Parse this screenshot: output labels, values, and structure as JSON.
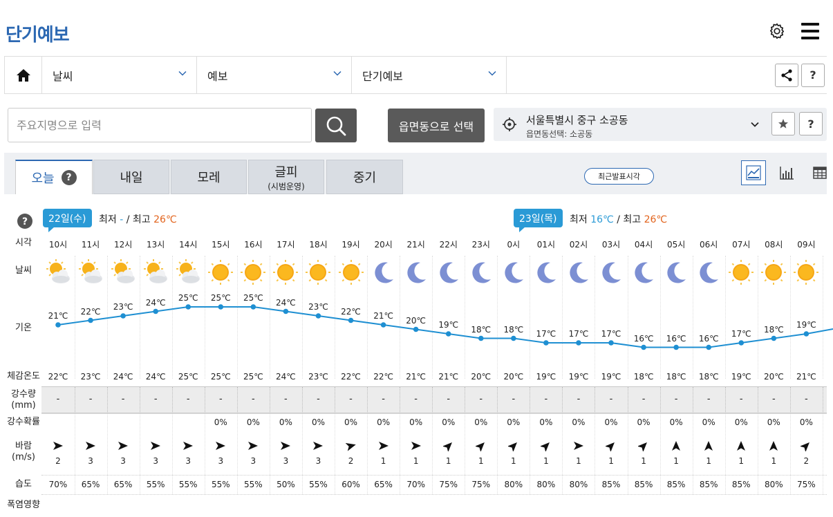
{
  "header": {
    "title": "단기예보"
  },
  "nav": {
    "items": [
      "날씨",
      "예보",
      "단기예보"
    ],
    "help": "?"
  },
  "search": {
    "placeholder": "주요지명으로 입력",
    "dong_button": "읍면동으로 선택"
  },
  "location": {
    "main": "서울특별시 중구 소공동",
    "sub": "읍면동선택: 소공동",
    "help": "?"
  },
  "tabs": [
    {
      "label": "오늘"
    },
    {
      "label": "내일"
    },
    {
      "label": "모레"
    },
    {
      "label": "글피",
      "sub": "(시범운영)"
    },
    {
      "label": "중기"
    }
  ],
  "tab_help": "?",
  "recent_button": "최근발표시각",
  "help_icon": "?",
  "days": [
    {
      "label": "22일(수)",
      "min_label": "최저",
      "min": "-",
      "sep": "/",
      "max_label": "최고",
      "max": "26℃"
    },
    {
      "label": "23일(목)",
      "min_label": "최저",
      "min": "16℃",
      "sep": "/",
      "max_label": "최고",
      "max": "26℃"
    }
  ],
  "row_labels": {
    "time": "시각",
    "weather": "날씨",
    "temp": "기온",
    "feel": "체감온도",
    "rain_line1": "강수량",
    "rain_line2": "(mm)",
    "prob": "강수확률",
    "wind_line1": "바람",
    "wind_line2": "(m/s)",
    "humidity": "습도",
    "heat": "폭염영향"
  },
  "colors": {
    "accent": "#2c68b2",
    "badge": "#2a9ad6",
    "max_temp": "#e2631c",
    "line": "#1e8fd2"
  },
  "forecast": {
    "times": [
      "10시",
      "11시",
      "12시",
      "13시",
      "14시",
      "15시",
      "16시",
      "17시",
      "18시",
      "19시",
      "20시",
      "21시",
      "22시",
      "23시",
      "0시",
      "01시",
      "02시",
      "03시",
      "04시",
      "05시",
      "06시",
      "07시",
      "08시",
      "09시"
    ],
    "weather": [
      "partly-cloudy",
      "partly-cloudy",
      "partly-cloudy",
      "partly-cloudy",
      "partly-cloudy",
      "sunny",
      "sunny",
      "sunny",
      "sunny",
      "sunny",
      "moon",
      "moon",
      "moon",
      "moon",
      "moon",
      "moon",
      "moon",
      "moon",
      "moon",
      "moon",
      "moon",
      "sunny",
      "sunny",
      "sunny"
    ],
    "temp_values": [
      21,
      22,
      23,
      24,
      25,
      25,
      25,
      24,
      23,
      22,
      21,
      20,
      19,
      18,
      18,
      17,
      17,
      17,
      16,
      16,
      16,
      17,
      18,
      19
    ],
    "temps": [
      "21℃",
      "22℃",
      "23℃",
      "24℃",
      "25℃",
      "25℃",
      "25℃",
      "24℃",
      "23℃",
      "22℃",
      "21℃",
      "20℃",
      "19℃",
      "18℃",
      "18℃",
      "17℃",
      "17℃",
      "17℃",
      "16℃",
      "16℃",
      "16℃",
      "17℃",
      "18℃",
      "19℃"
    ],
    "feels": [
      "22℃",
      "23℃",
      "24℃",
      "24℃",
      "25℃",
      "25℃",
      "25℃",
      "24℃",
      "23℃",
      "22℃",
      "22℃",
      "21℃",
      "21℃",
      "20℃",
      "20℃",
      "19℃",
      "19℃",
      "19℃",
      "18℃",
      "18℃",
      "18℃",
      "19℃",
      "20℃",
      "21℃"
    ],
    "rain": [
      "-",
      "-",
      "-",
      "-",
      "-",
      "-",
      "-",
      "-",
      "-",
      "-",
      "-",
      "-",
      "-",
      "-",
      "-",
      "-",
      "-",
      "-",
      "-",
      "-",
      "-",
      "-",
      "-",
      "-"
    ],
    "prob": [
      "",
      "",
      "",
      "",
      "",
      "0%",
      "0%",
      "0%",
      "0%",
      "0%",
      "0%",
      "0%",
      "0%",
      "0%",
      "0%",
      "0%",
      "0%",
      "0%",
      "0%",
      "0%",
      "0%",
      "0%",
      "0%",
      "0%"
    ],
    "wind_dir_deg": [
      90,
      90,
      90,
      90,
      90,
      90,
      90,
      90,
      90,
      75,
      90,
      90,
      45,
      45,
      45,
      45,
      90,
      45,
      45,
      0,
      0,
      0,
      0,
      45
    ],
    "wind_speed": [
      "2",
      "3",
      "3",
      "3",
      "3",
      "3",
      "3",
      "3",
      "3",
      "2",
      "1",
      "1",
      "1",
      "1",
      "1",
      "1",
      "1",
      "1",
      "1",
      "1",
      "1",
      "1",
      "1",
      "2"
    ],
    "humidity": [
      "70%",
      "65%",
      "65%",
      "55%",
      "55%",
      "55%",
      "55%",
      "50%",
      "55%",
      "60%",
      "65%",
      "70%",
      "75%",
      "75%",
      "80%",
      "80%",
      "80%",
      "85%",
      "85%",
      "85%",
      "85%",
      "85%",
      "80%",
      "75%"
    ]
  }
}
